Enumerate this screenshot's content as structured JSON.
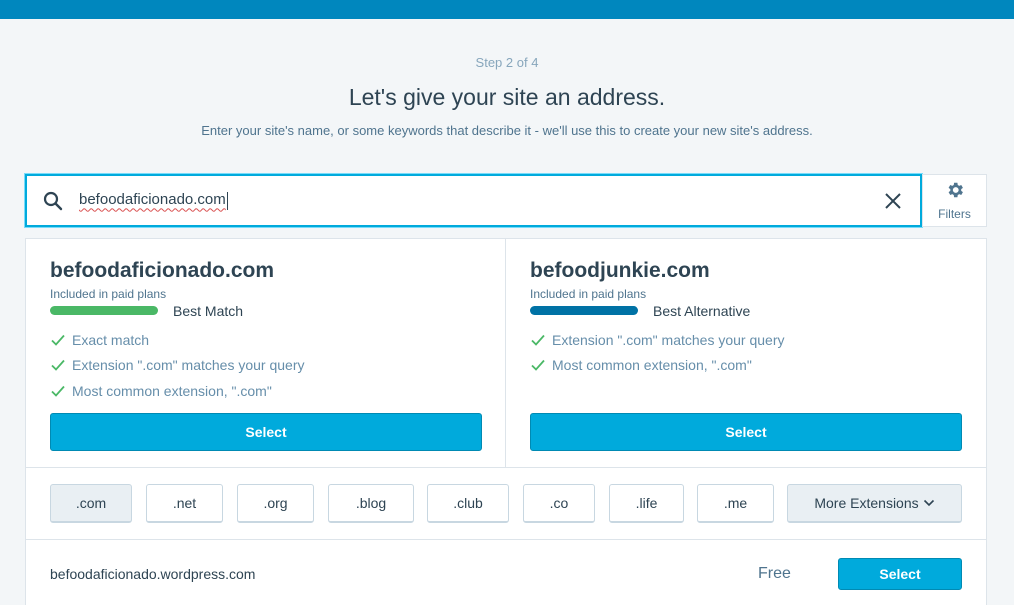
{
  "header": {
    "step": "Step 2 of 4",
    "title": "Let's give your site an address.",
    "subtitle": "Enter your site's name, or some keywords that describe it - we'll use this to create your new site's address."
  },
  "search": {
    "query": "befoodaficionado.com",
    "icon": "search-icon",
    "clear_icon": "close-icon"
  },
  "filters": {
    "label": "Filters",
    "icon": "gear-icon"
  },
  "suggestions": [
    {
      "domain": "befoodaficionado.com",
      "plan": "Included in paid plans",
      "badge": "Best Match",
      "badge_color": "#4ab866",
      "reasons": [
        "Exact match",
        "Extension \".com\" matches your query",
        "Most common extension, \".com\""
      ],
      "button": "Select"
    },
    {
      "domain": "befoodjunkie.com",
      "plan": "Included in paid plans",
      "badge": "Best Alternative",
      "badge_color": "#0072a5",
      "reasons": [
        "Extension \".com\" matches your query",
        "Most common extension, \".com\""
      ],
      "button": "Select"
    }
  ],
  "tlds": [
    ".com",
    ".net",
    ".org",
    ".blog",
    ".club",
    ".co",
    ".life",
    ".me"
  ],
  "more_extensions": "More Extensions",
  "wordpress": {
    "domain": "befoodaficionado.wordpress.com",
    "price": "Free",
    "button": "Select"
  },
  "colors": {
    "accent": "#00aadc",
    "topbar": "#0087be",
    "check": "#4ab866"
  }
}
